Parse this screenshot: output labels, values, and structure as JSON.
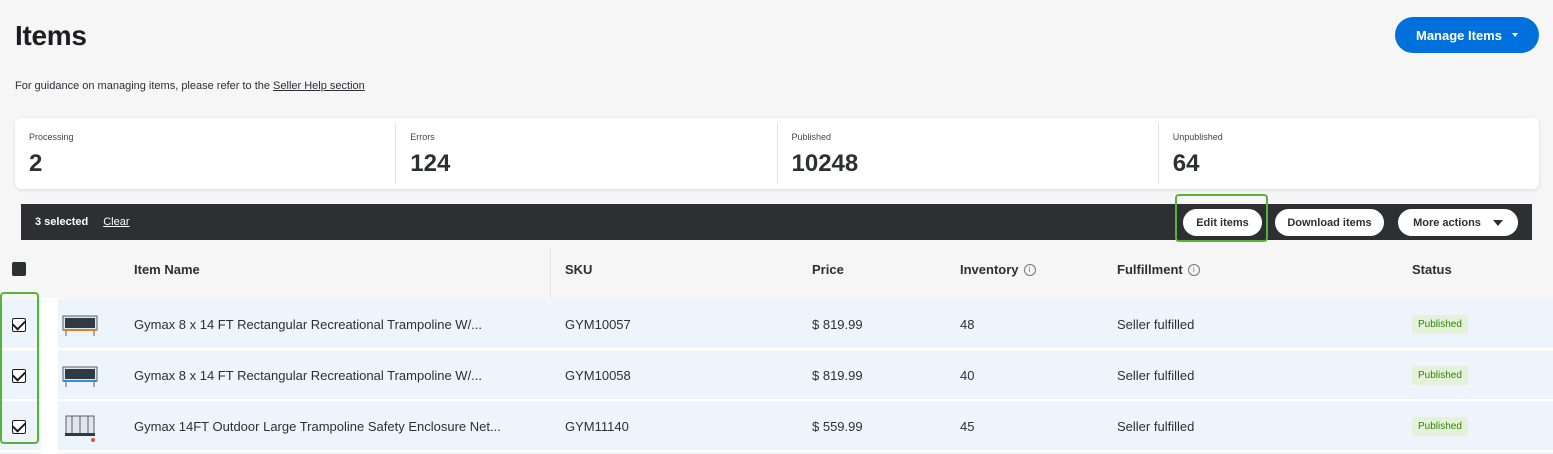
{
  "header": {
    "title": "Items",
    "manage_button": "Manage Items",
    "guidance_prefix": "For guidance on managing items, please refer to the ",
    "guidance_link": "Seller Help section"
  },
  "stats": [
    {
      "label": "Processing",
      "value": "2"
    },
    {
      "label": "Errors",
      "value": "124"
    },
    {
      "label": "Published",
      "value": "10248"
    },
    {
      "label": "Unpublished",
      "value": "64"
    }
  ],
  "action_bar": {
    "selected": "3 selected",
    "clear": "Clear",
    "edit_items": "Edit items",
    "download_items": "Download items",
    "more_actions": "More actions"
  },
  "table": {
    "columns": {
      "item_name": "Item Name",
      "sku": "SKU",
      "price": "Price",
      "inventory": "Inventory",
      "fulfillment": "Fulfillment",
      "status": "Status"
    },
    "info_glyph": "i",
    "rows": [
      {
        "name": "Gymax 8 x 14 FT Rectangular Recreational Trampoline W/...",
        "sku": "GYM10057",
        "price": "$ 819.99",
        "inventory": "48",
        "fulfillment": "Seller fulfilled",
        "status": "Published",
        "checked": true
      },
      {
        "name": "Gymax 8 x 14 FT Rectangular Recreational Trampoline W/...",
        "sku": "GYM10058",
        "price": "$ 819.99",
        "inventory": "40",
        "fulfillment": "Seller fulfilled",
        "status": "Published",
        "checked": true
      },
      {
        "name": "Gymax 14FT Outdoor Large Trampoline Safety Enclosure Net...",
        "sku": "GYM11140",
        "price": "$ 559.99",
        "inventory": "45",
        "fulfillment": "Seller fulfilled",
        "status": "Published",
        "checked": true
      }
    ]
  },
  "colors": {
    "primary": "#0071dc",
    "action_bar": "#2e2f32",
    "row_selected": "#eef4fb",
    "status_green": "#2a8703",
    "highlight": "#58b33a"
  }
}
